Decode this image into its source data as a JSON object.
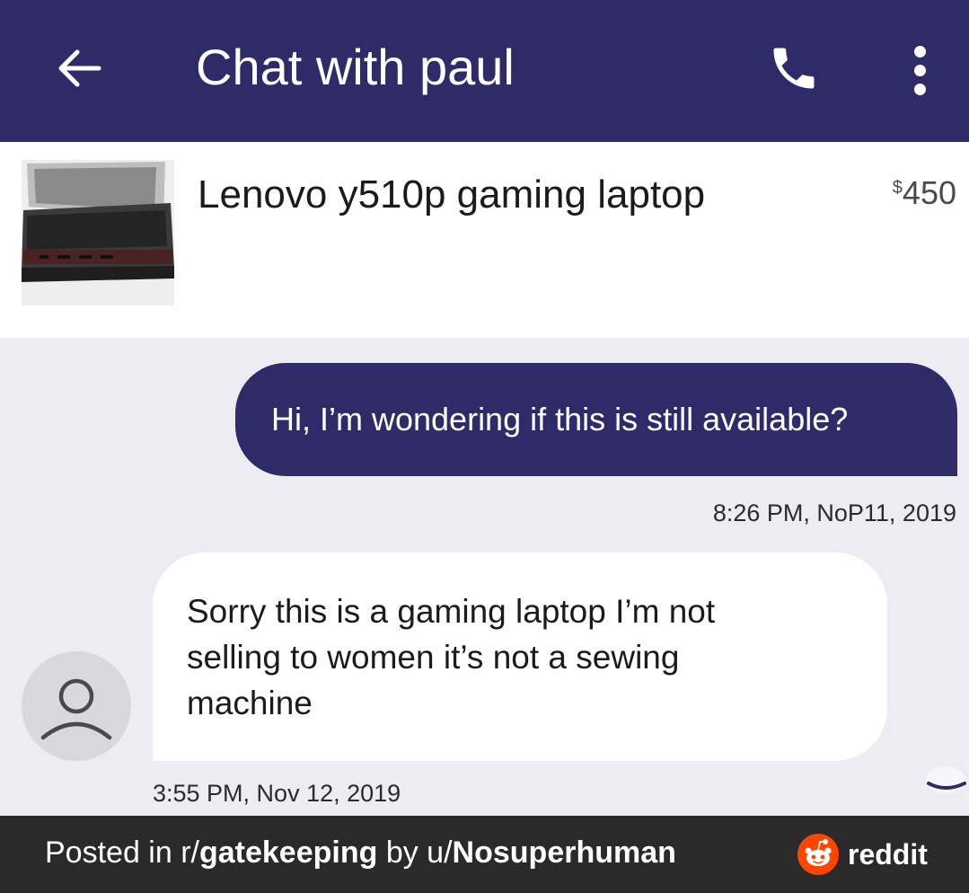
{
  "header": {
    "title": "Chat with paul",
    "back_icon": "arrow-left-icon",
    "call_icon": "phone-icon",
    "menu_icon": "more-vertical-icon",
    "bg_color": "#2f2a68"
  },
  "listing": {
    "title": "Lenovo y510p gaming laptop",
    "price_symbol": "$",
    "price": "450"
  },
  "messages": [
    {
      "direction": "outgoing",
      "text": "Hi, I’m wondering if this is still available?",
      "timestamp": "8:26 PM, NoP11, 2019"
    },
    {
      "direction": "incoming",
      "lines": [
        "Sorry this is a gaming laptop I’m not",
        "selling to women it’s not a sewing",
        "machine"
      ],
      "timestamp": "3:55 PM, Nov 12, 2019"
    }
  ],
  "footer": {
    "posted_in": "Posted in r/",
    "subreddit": "gatekeeping",
    "by": " by u/",
    "username": "Nosuperhuman",
    "brand": "reddit",
    "brand_color": "#ff4500"
  }
}
